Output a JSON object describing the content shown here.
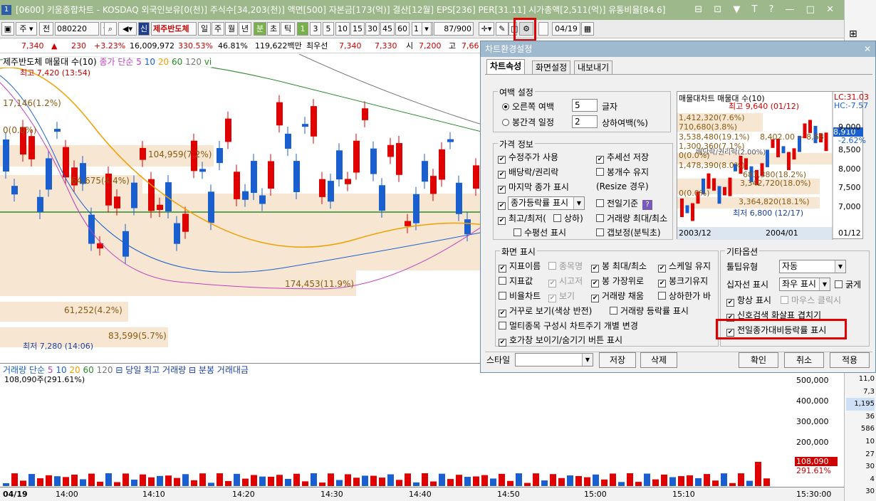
{
  "window": {
    "number": "1",
    "title": "[0600] 키움종합차트 - KOSDAQ 외국인보유[0(천)] 주식수[34,203(천)] 액면[500] 자본금[173(억)] 결산[12월] EPS[236] PER[31.11] 시가총액[2,511(억)] 유통비율[84.6]",
    "buttons": [
      "1",
      "⊟",
      "⊡",
      "▼",
      "T",
      "?",
      "—",
      "□",
      "✕"
    ]
  },
  "toolbar": {
    "period_sel": "주",
    "jeon": "전",
    "code": "080220",
    "stock_name": "제주반도체",
    "periods": [
      "일",
      "주",
      "월",
      "년",
      "분",
      "초",
      "틱"
    ],
    "active_period": "분",
    "minutes": [
      "1",
      "3",
      "5",
      "10",
      "15",
      "30",
      "45",
      "60"
    ],
    "minute_select": "1",
    "count": "87/900",
    "date": "04/19"
  },
  "price": {
    "current": "7,340",
    "change": "230",
    "change_pct": "+3.23%",
    "volume": "16,009,972",
    "volume_pct": "330.53%",
    "ratio": "46.81%",
    "amount": "119,622백만",
    "bid_label": "최우선",
    "bid1": "7,340",
    "bid2": "7,330",
    "open_label": "시",
    "open": "7,200",
    "high_label": "고",
    "high": "7,66"
  },
  "chart": {
    "legend_title": "제주반도체 매물대 수(10)",
    "ma_label": "종가 단순",
    "ma_periods": [
      "5",
      "10",
      "20",
      "60",
      "120"
    ],
    "vi": "vi",
    "max_label": "최고 7,420 (13:54)",
    "min_label": "최저 7,280 (14:06)",
    "vp_labels": [
      "17,146(1.2%)",
      "0(0.0%)",
      "104,959(7.2%)",
      "64,675(4.4%)",
      "174,453(11.9%)",
      "61,252(4.2%)",
      "83,599(5.7%)"
    ]
  },
  "volume": {
    "legend": "거래량 단순",
    "ma_periods": [
      "5",
      "10",
      "20",
      "60",
      "120"
    ],
    "extra1": "당일 최고 거래량",
    "extra2": "분봉 거래대금",
    "max_note": "108,090주(291.61%)",
    "y_ticks": [
      "500,000",
      "400,000",
      "300,000",
      "200,000",
      "100,000"
    ],
    "current": "108,090",
    "current_pct": "291.61%"
  },
  "time_axis": [
    "04/19",
    "14:00",
    "14:10",
    "14:20",
    "14:30",
    "14:40",
    "14:50",
    "15:00",
    "15:10",
    "15:30:00"
  ],
  "right_strip": [
    "11,0",
    "7,3",
    "1,195",
    "36",
    "586",
    "10",
    "27",
    "30",
    "4",
    "30"
  ],
  "dialog": {
    "title": "차트환경설정",
    "tabs": [
      "차트속성",
      "화면설정",
      "내보내기"
    ],
    "margin_group": "여백 설정",
    "margin_right": "오른쪽 여백",
    "margin_right_val": "5",
    "margin_unit": "글자",
    "margin_gap": "봉간격 일정",
    "margin_gap_val": "2",
    "margin_gap_unit": "상하여백(%)",
    "price_group": "가격 정보",
    "price_opts": [
      "수정주가 사용",
      "배당락/권리락",
      "마지막 종가 표시",
      "최고/최저(",
      "상하)",
      "수평선 표시"
    ],
    "price_opts_r": [
      "추세선 저장",
      "봉개수 유지",
      "(Resize 경우)",
      "전일기준",
      "거래량 최대/최소",
      "갭보정(분틱초)"
    ],
    "change_sel": "종가등락률 표시",
    "screen_group": "화면 표시",
    "screen_opts": {
      "c1": [
        "지표이름",
        "지표값",
        "비율차트",
        "거꾸로 보기(색상 반전)",
        "멀티종목 구성시 차트주기 개별 변경",
        "호가창 보이기/숨기기 버튼 표시"
      ],
      "c2": [
        "종목명",
        "시고저",
        "보기",
        "거래량 등락률 표시"
      ],
      "c3": [
        "봉 최대/최소",
        "봉 가장위로",
        "거래량 채움"
      ],
      "c4": [
        "스케일 유지",
        "봉크기유지",
        "상하한가 바"
      ]
    },
    "etc_group": "기타옵션",
    "tooltip_label": "툴팁유형",
    "tooltip_val": "자동",
    "cross_label": "십자선 표시",
    "cross_val": "좌우 표시",
    "bold": "굵게",
    "always": "항상 표시",
    "mouse_click": "마우스 클릭시",
    "signal_arrow": "신호검색 화살표 겹치기",
    "prev_close_pct": "전일종가대비등락률 표시",
    "style_label": "스타일",
    "save": "저장",
    "delete": "삭제",
    "ok": "확인",
    "cancel": "취소",
    "apply": "적용",
    "preview": {
      "title": "매물대차트 매물대 수(10)",
      "lc": "LC:31.03",
      "hc": "HC:-7.57",
      "max": "최고 9,640 (01/12)",
      "min": "최저 6,800 (12/17)",
      "labels": [
        "1,412,320(7.6%)",
        "710,680(3.8%)",
        "3,538,480(19.1%)",
        "1,300,360(7.1%)",
        "0(0.0%)",
        "1,478,390(8.0%)",
        "683,380(18.2%)",
        "3,342,720(18.0%)",
        "0(0.0%)",
        "3,364,820(18.1%)"
      ],
      "mid": "8,402.00 ~ 8,68",
      "note": "배당락/권리락(2.00%)",
      "price": "8,910",
      "price_pct": "-2.62%",
      "yticks": [
        "9,000",
        "8,500",
        "8,000",
        "7,500",
        "7,000"
      ],
      "dates": [
        "2003/12",
        "2004/01",
        "01/12"
      ]
    }
  },
  "colors": {
    "up": "#e00000",
    "down": "#1a5fd0",
    "title": "#9db88a",
    "highlight": "#e00000"
  }
}
